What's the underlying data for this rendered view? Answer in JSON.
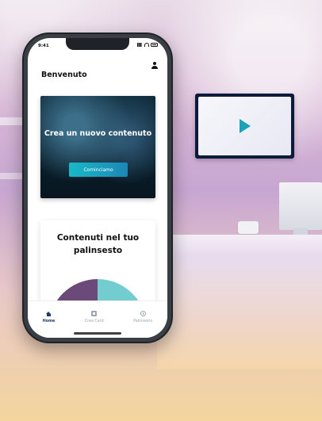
{
  "status_bar": {
    "time": "9:41"
  },
  "header": {
    "title": "Benvenuto",
    "profile_icon": "user-icon"
  },
  "hero": {
    "title": "Crea un nuovo contenuto",
    "button_label": "Cominciamo",
    "accent_colors": [
      "#18b9c7",
      "#1d86b7"
    ]
  },
  "chart_card": {
    "title": "Contenuti nel tuo palinsesto"
  },
  "chart_data": {
    "type": "pie",
    "slices": [
      {
        "value": 40,
        "color": "#73cdd0"
      },
      {
        "value": 10,
        "color": "#b85a87"
      },
      {
        "value": 50,
        "color": "#6b4a7a"
      }
    ]
  },
  "bottom_nav": {
    "items": [
      {
        "label": "Home",
        "icon": "home-icon",
        "active": true
      },
      {
        "label": "Crea Card",
        "icon": "create-card-icon",
        "active": false
      },
      {
        "label": "Palinsesto",
        "icon": "palinsesto-icon",
        "active": false
      }
    ]
  }
}
